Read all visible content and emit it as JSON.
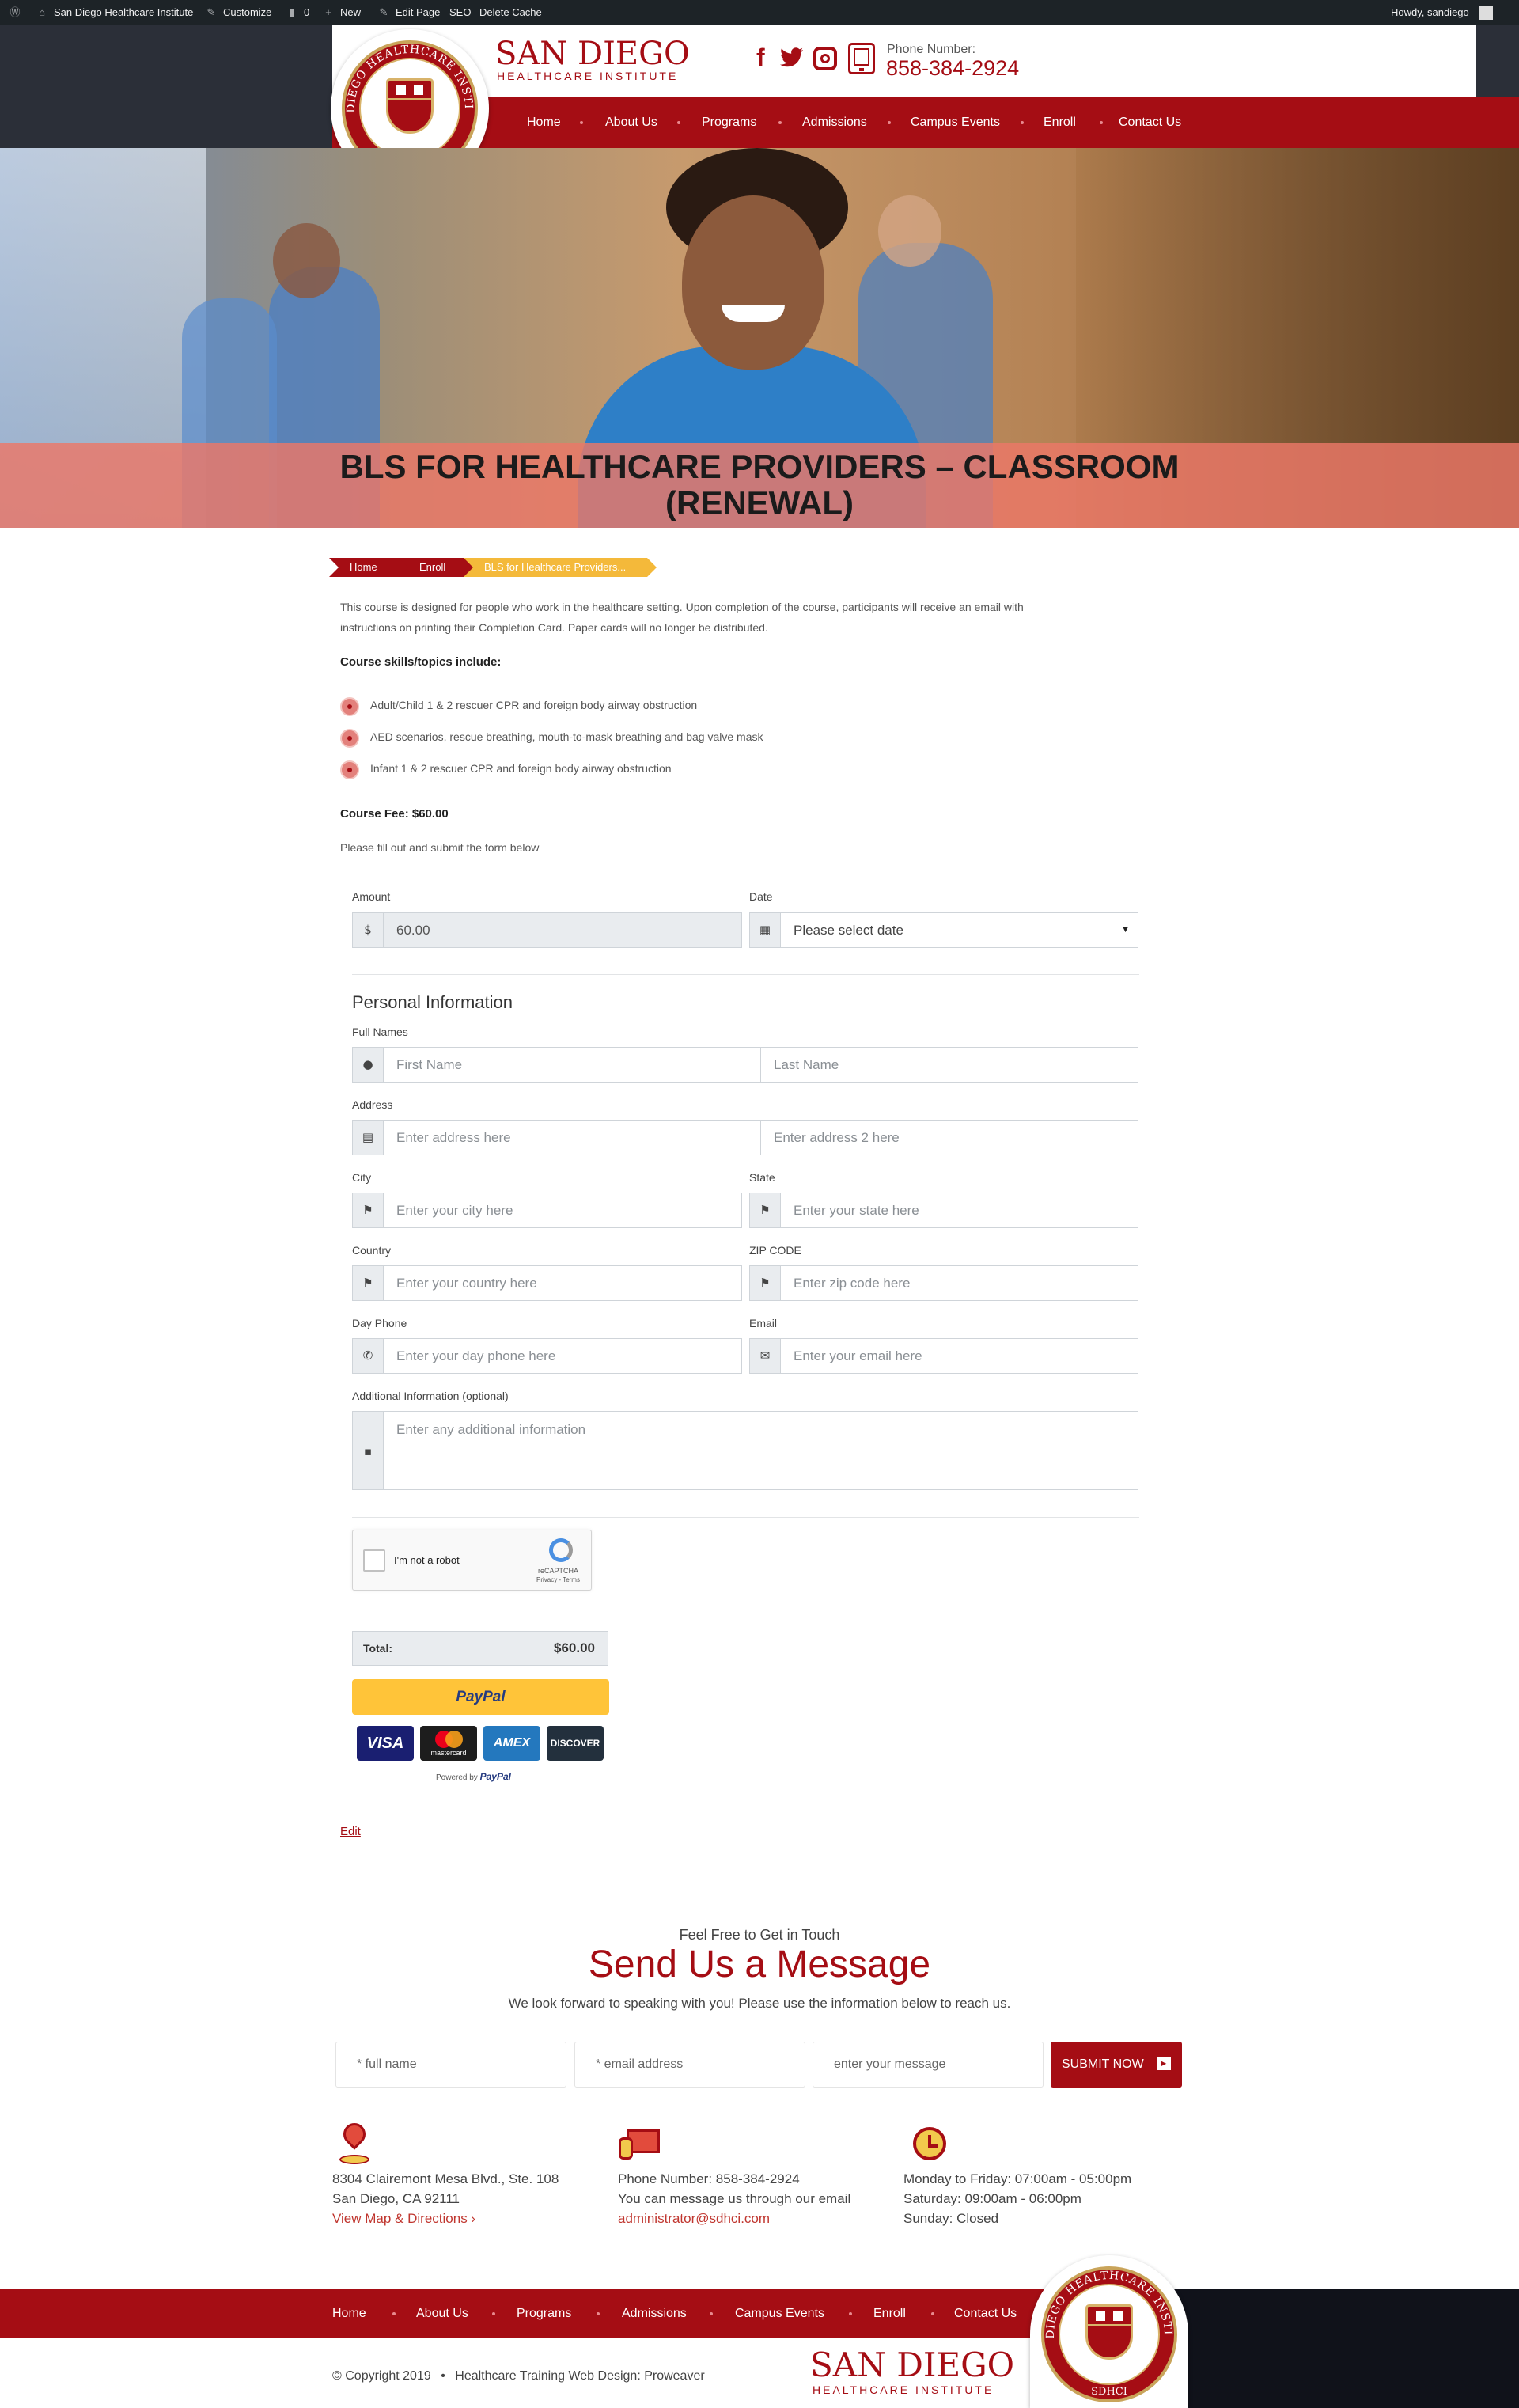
{
  "admin_bar": {
    "site_name": "San Diego Healthcare Institute",
    "customize": "Customize",
    "comments": "0",
    "new": "New",
    "edit_page": "Edit Page",
    "seo": "SEO",
    "delete_cache": "Delete Cache",
    "howdy": "Howdy, sandiego"
  },
  "header": {
    "brand_line1": "SAN DIEGO",
    "brand_line2": "HEALTHCARE INSTITUTE",
    "seal_top": "SAN DIEGO HEALTHCARE INSTITUTE",
    "seal_bottom": "SDHCI",
    "phone_label": "Phone Number:",
    "phone_number": "858-384-2924",
    "social_icons": [
      "facebook-icon",
      "twitter-icon",
      "instagram-icon"
    ]
  },
  "nav": [
    "Home",
    "About Us",
    "Programs",
    "Admissions",
    "Campus Events",
    "Enroll",
    "Contact Us"
  ],
  "hero": {
    "title_line1": "BLS FOR HEALTHCARE PROVIDERS – CLASSROOM",
    "title_line2": "(RENEWAL)"
  },
  "breadcrumb": [
    "Home",
    "Enroll",
    "BLS for Healthcare Providers..."
  ],
  "intro": {
    "line1": "This course is designed for people who work in the healthcare setting. Upon completion of the course, participants will receive an email with",
    "line2": "instructions on printing their Completion Card. Paper cards will no longer be distributed.",
    "skills_heading": "Course skills/topics include:",
    "skills": [
      "Adult/Child 1 & 2 rescuer CPR and foreign body airway obstruction",
      "AED scenarios, rescue breathing, mouth-to-mask breathing and bag valve mask",
      "Infant 1 & 2 rescuer CPR and foreign body airway obstruction"
    ],
    "fee": "Course Fee: $60.00",
    "instructions": "Please fill out and submit the form below"
  },
  "form": {
    "amount_label": "Amount",
    "currency_symbol": "$",
    "amount_value": "60.00",
    "date_label": "Date",
    "date_placeholder": "Please select date",
    "personal_heading": "Personal Information",
    "full_names_label": "Full Names",
    "first_name_placeholder": "First Name",
    "last_name_placeholder": "Last Name",
    "address_label": "Address",
    "address1_placeholder": "Enter address here",
    "address2_placeholder": "Enter address 2 here",
    "city_label": "City",
    "city_placeholder": "Enter your city here",
    "state_label": "State",
    "state_placeholder": "Enter your state here",
    "country_label": "Country",
    "country_placeholder": "Enter your country here",
    "zip_label": "ZIP CODE",
    "zip_placeholder": "Enter zip code here",
    "day_phone_label": "Day Phone",
    "day_phone_placeholder": "Enter your day phone here",
    "email_label": "Email",
    "email_placeholder": "Enter your email here",
    "additional_label": "Additional Information (optional)",
    "additional_placeholder": "Enter any additional information",
    "captcha_text": "I'm not a robot",
    "captcha_brand": "reCAPTCHA",
    "captcha_links": "Privacy - Terms",
    "total_label": "Total:",
    "total_value": "$60.00",
    "paypal_button": "PayPal",
    "cards": [
      "VISA",
      "mastercard",
      "AMEX",
      "DISCOVER"
    ],
    "powered_by": "Powered by",
    "powered_brand": "PayPal"
  },
  "edit_link": "Edit",
  "contact": {
    "kicker": "Feel Free to Get in Touch",
    "title": "Send Us a Message",
    "subtitle": "We look forward to speaking with you! Please use the information below to reach us.",
    "name_placeholder": "* full name",
    "email_placeholder": "* email address",
    "message_placeholder": "enter your message",
    "submit_label": "SUBMIT NOW",
    "address_line1": "8304 Clairemont Mesa Blvd., Ste. 108",
    "address_line2": "San Diego, CA 92111",
    "map_link": "View Map & Directions ›",
    "phone_line": "Phone Number: 858-384-2924",
    "message_line": "You can message us through our email",
    "email_link": "administrator@sdhci.com",
    "hours_line1": "Monday to Friday: 07:00am - 05:00pm",
    "hours_line2": "Saturday: 09:00am - 06:00pm",
    "hours_line3": "Sunday: Closed"
  },
  "footer": {
    "nav": [
      "Home",
      "About Us",
      "Programs",
      "Admissions",
      "Campus Events",
      "Enroll",
      "Contact Us"
    ],
    "copyright": "© Copyright 2019",
    "credit": "Healthcare Training Web Design: Proweaver",
    "brand_line1": "SAN DIEGO",
    "brand_line2": "HEALTHCARE INSTITUTE"
  },
  "colors": {
    "brand_red": "#a50d14",
    "gold": "#f4b93a",
    "dark": "#2b2f38"
  }
}
